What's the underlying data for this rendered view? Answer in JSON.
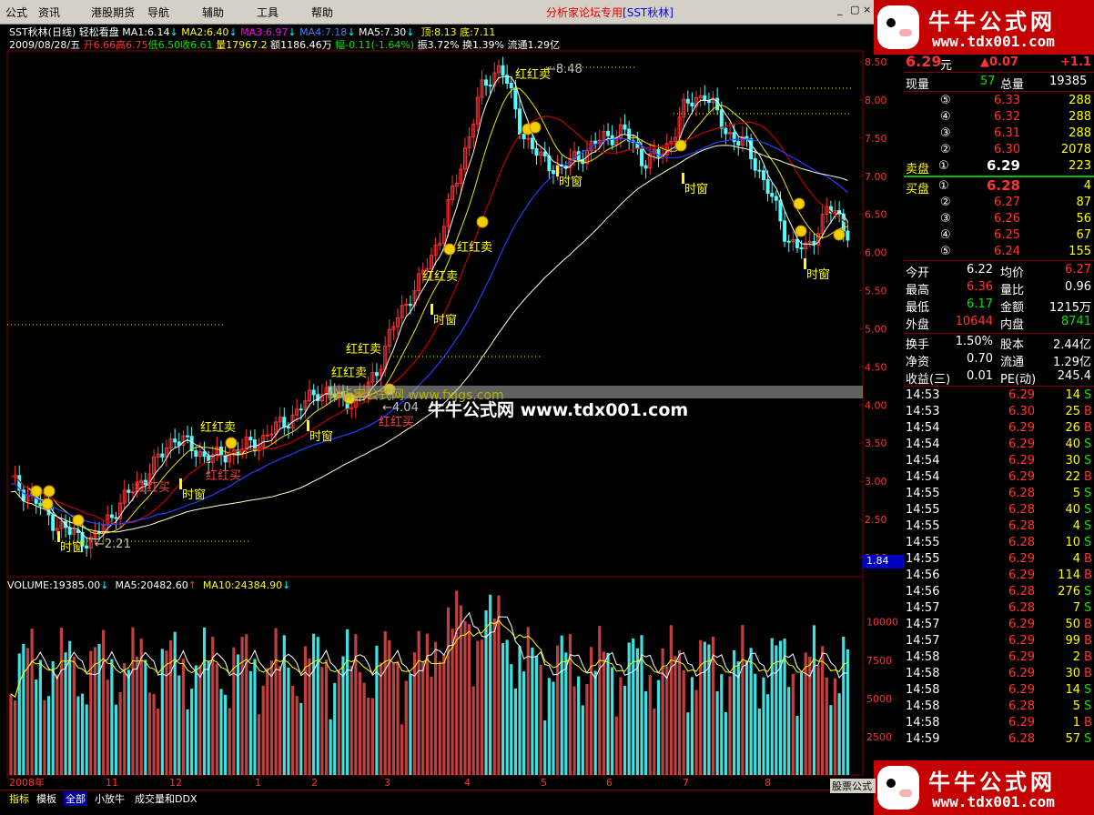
{
  "menu": {
    "items": [
      "公式",
      "资讯",
      "港股期货",
      "导航",
      "辅助",
      "工具",
      "帮助"
    ],
    "title_red": "分析家论坛专用",
    "title_blue": "[SST秋林]",
    "window_buttons": [
      "_",
      "▢",
      "×"
    ]
  },
  "logo": {
    "brand": "牛牛公式网",
    "url": "www.tdx001.com"
  },
  "chart_header": {
    "name": "SST秋林(日线)",
    "mode": "轻松看盘",
    "ma1": "MA1:6.14",
    "ma2": "MA2:6.40",
    "ma3": "MA3:6.97",
    "ma4": "MA4:7.18",
    "ma5": "MA5:7.30",
    "top": "顶:8.13",
    "bottom": "底:7.11",
    "date": "2009/08/28/五",
    "open": "开6.66",
    "high": "高6.75",
    "low": "低6.50",
    "close": "收6.61",
    "vol": "量17967.2",
    "amount": "额1186.46万",
    "change": "幅-0.11(-1.64%)",
    "amplitude": "振3.72%",
    "turnover": "换1.39%",
    "float": "流通1.29亿"
  },
  "volume_header": {
    "volume": "VOLUME:19385.00",
    "ma5": "MA5:20482.60",
    "ma10": "MA10:24384.90"
  },
  "annotations": {
    "high_marker": "8.48",
    "low_marker": "2.21",
    "mid_marker": "4.04",
    "buy_label": "红红买",
    "sell_label": "红红卖",
    "window_label": "时窗",
    "watermark_main": "牛牛公式网 www.tdx001.com",
    "watermark_sub": "分析家公式网 www.fxjgs.com",
    "badge_value": "1.84"
  },
  "price_axis": [
    "8.50",
    "8.00",
    "7.50",
    "7.00",
    "6.50",
    "6.00",
    "5.50",
    "5.00",
    "4.50",
    "4.00",
    "3.50",
    "3.00",
    "2.50",
    "2.00"
  ],
  "volume_axis": [
    "10000",
    "7500",
    "5000",
    "2500"
  ],
  "time_axis": [
    "2008年",
    "11",
    "12",
    "1",
    "2",
    "3",
    "4",
    "5",
    "6",
    "7",
    "8"
  ],
  "quote": {
    "price": "6.29",
    "price_unit": "元",
    "change": "▲0.07",
    "change_pct": "+1.1",
    "now_vol_label": "现量",
    "now_vol": "57",
    "total_vol_label": "总量",
    "total_vol": "19385",
    "sell_label": "卖盘",
    "buy_label": "买盘",
    "asks": [
      {
        "level": "⑤",
        "price": "6.33",
        "vol": "288"
      },
      {
        "level": "④",
        "price": "6.32",
        "vol": "288"
      },
      {
        "level": "③",
        "price": "6.31",
        "vol": "288"
      },
      {
        "level": "②",
        "price": "6.30",
        "vol": "2078"
      },
      {
        "level": "①",
        "price": "6.29",
        "vol": "223"
      }
    ],
    "bids": [
      {
        "level": "①",
        "price": "6.28",
        "vol": "4"
      },
      {
        "level": "②",
        "price": "6.27",
        "vol": "87"
      },
      {
        "level": "③",
        "price": "6.26",
        "vol": "56"
      },
      {
        "level": "④",
        "price": "6.25",
        "vol": "67"
      },
      {
        "level": "⑤",
        "price": "6.24",
        "vol": "155"
      }
    ],
    "stats": [
      {
        "l1": "今开",
        "v1": "6.22",
        "c1": "white",
        "l2": "均价",
        "v2": "6.27",
        "c2": "red"
      },
      {
        "l1": "最高",
        "v1": "6.36",
        "c1": "red",
        "l2": "量比",
        "v2": "0.96",
        "c2": "white"
      },
      {
        "l1": "最低",
        "v1": "6.17",
        "c1": "green",
        "l2": "金额",
        "v2": "1215万",
        "c2": "white"
      },
      {
        "l1": "外盘",
        "v1": "10644",
        "c1": "red",
        "l2": "内盘",
        "v2": "8741",
        "c2": "green"
      }
    ],
    "stats2": [
      {
        "l1": "换手",
        "v1": "1.50%",
        "l2": "股本",
        "v2": "2.44亿"
      },
      {
        "l1": "净资",
        "v1": "0.70",
        "l2": "流通",
        "v2": "1.29亿"
      },
      {
        "l1": "收益(三)",
        "v1": "0.01",
        "l2": "PE(动)",
        "v2": "245.4"
      }
    ],
    "ticks": [
      {
        "t": "14:53",
        "p": "6.29",
        "v": "14",
        "s": "S"
      },
      {
        "t": "14:53",
        "p": "6.30",
        "v": "25",
        "s": "B"
      },
      {
        "t": "14:54",
        "p": "6.29",
        "v": "26",
        "s": "B"
      },
      {
        "t": "14:54",
        "p": "6.29",
        "v": "40",
        "s": "S"
      },
      {
        "t": "14:54",
        "p": "6.29",
        "v": "30",
        "s": "S"
      },
      {
        "t": "14:54",
        "p": "6.29",
        "v": "22",
        "s": "B"
      },
      {
        "t": "14:55",
        "p": "6.28",
        "v": "5",
        "s": "S"
      },
      {
        "t": "14:55",
        "p": "6.28",
        "v": "40",
        "s": "S"
      },
      {
        "t": "14:55",
        "p": "6.28",
        "v": "4",
        "s": "S"
      },
      {
        "t": "14:55",
        "p": "6.28",
        "v": "10",
        "s": "S"
      },
      {
        "t": "14:55",
        "p": "6.29",
        "v": "4",
        "s": "B"
      },
      {
        "t": "14:56",
        "p": "6.29",
        "v": "114",
        "s": "B"
      },
      {
        "t": "14:56",
        "p": "6.28",
        "v": "276",
        "s": "S"
      },
      {
        "t": "14:57",
        "p": "6.28",
        "v": "7",
        "s": "S"
      },
      {
        "t": "14:57",
        "p": "6.29",
        "v": "50",
        "s": "B"
      },
      {
        "t": "14:57",
        "p": "6.29",
        "v": "99",
        "B": "",
        "s": "B"
      },
      {
        "t": "14:58",
        "p": "6.29",
        "v": "2",
        "s": "B"
      },
      {
        "t": "14:58",
        "p": "6.29",
        "v": "30",
        "s": "B"
      },
      {
        "t": "14:58",
        "p": "6.29",
        "v": "14",
        "s": "S"
      },
      {
        "t": "14:58",
        "p": "6.28",
        "v": "5",
        "s": "S"
      },
      {
        "t": "14:58",
        "p": "6.29",
        "v": "1",
        "s": "B"
      },
      {
        "t": "14:59",
        "p": "6.28",
        "v": "57",
        "s": "S"
      }
    ]
  },
  "bottom_tabs": [
    "指标",
    "模板",
    "全部",
    "小放牛",
    "成交量和DDX"
  ],
  "stock_badge": "股票公式",
  "colors": {
    "up": "#ff3232",
    "down": "#54fcfc",
    "ma1": "#ffffff",
    "ma2": "#ffff00",
    "ma3": "#ff00ff",
    "ma4": "#00c000",
    "ma5": "#c0c0c0",
    "line_white": "#ffffcc",
    "line_yellow": "#f0e000",
    "line_red": "#c00000",
    "line_blue": "#2040ff"
  },
  "chart_data": {
    "type": "line",
    "title": "SST秋林(日线)",
    "x_range": [
      "2008-10",
      "2009-08"
    ],
    "ylim": [
      2.0,
      8.6
    ],
    "series": [
      {
        "name": "收盘",
        "values": [
          3.0,
          2.8,
          2.5,
          2.3,
          2.21,
          2.6,
          2.9,
          3.2,
          3.6,
          3.4,
          3.3,
          3.4,
          3.5,
          3.7,
          3.9,
          4.2,
          4.1,
          4.04,
          4.5,
          5.2,
          5.6,
          6.2,
          7.1,
          8.1,
          8.48,
          7.6,
          7.2,
          7.1,
          7.3,
          7.5,
          7.6,
          7.2,
          7.3,
          7.9,
          8.1,
          7.6,
          7.4,
          6.9,
          6.2,
          6.0,
          6.6,
          6.29
        ]
      }
    ],
    "volume": {
      "ylim": [
        0,
        12000
      ]
    }
  }
}
